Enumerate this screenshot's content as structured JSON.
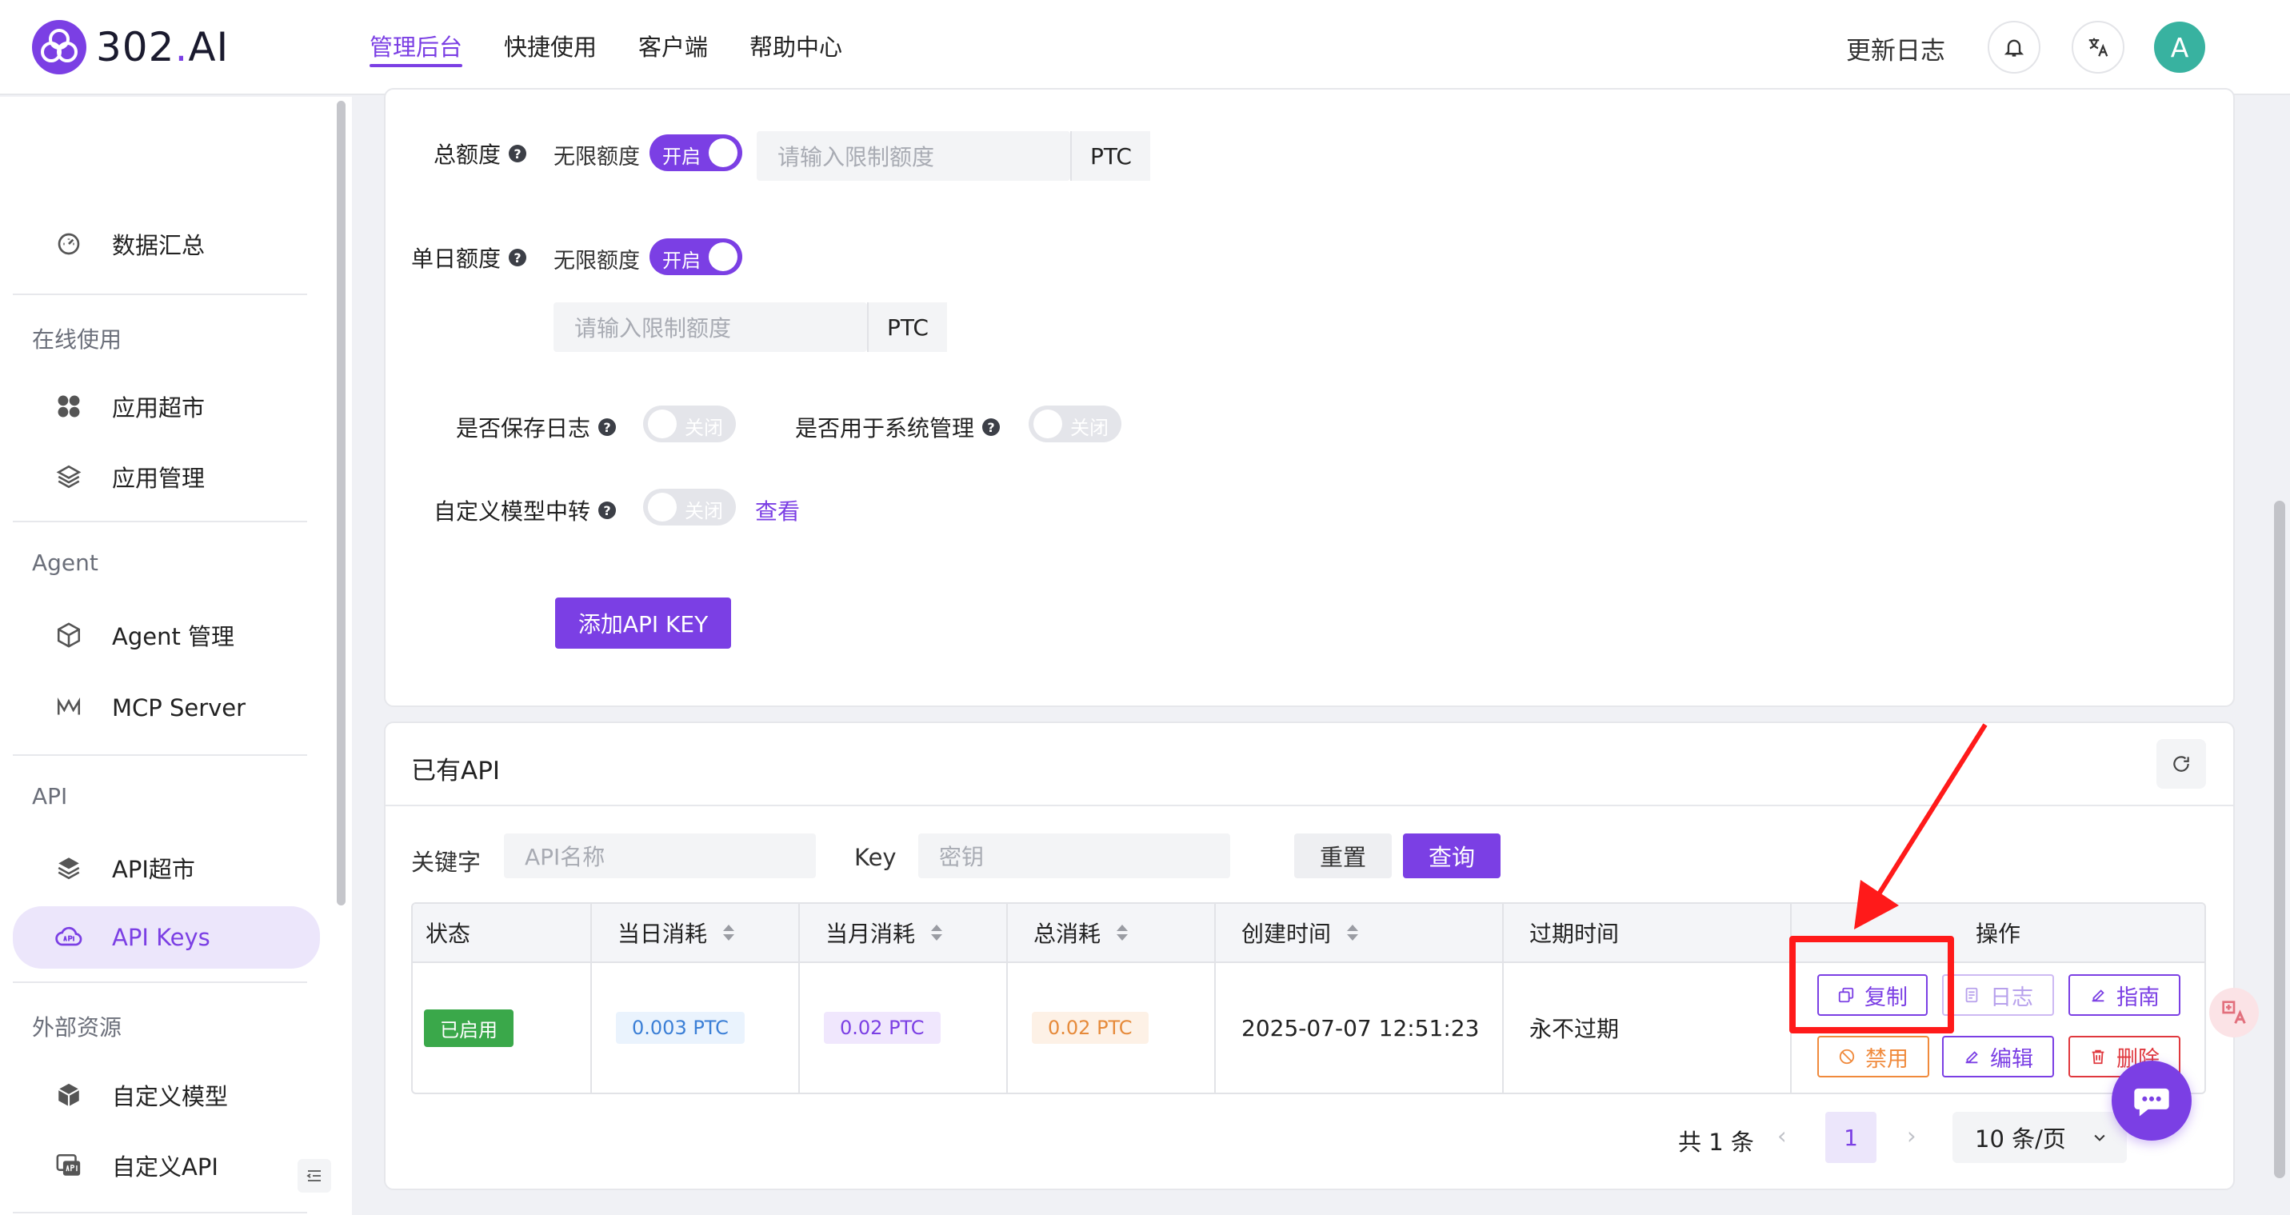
{
  "header": {
    "logo_text": "302",
    "logo_dot": ".",
    "logo_suffix": "AI",
    "nav": [
      "管理后台",
      "快捷使用",
      "客户端",
      "帮助中心"
    ],
    "changelog": "更新日志",
    "avatar_letter": "A"
  },
  "sidebar": {
    "dashboard": "数据汇总",
    "group_online": "在线使用",
    "app_market": "应用超市",
    "app_manage": "应用管理",
    "group_agent": "Agent",
    "agent_manage": "Agent 管理",
    "mcp_server": "MCP Server",
    "group_api": "API",
    "api_market": "API超市",
    "api_keys": "API Keys",
    "group_external": "外部资源",
    "custom_model": "自定义模型",
    "custom_api": "自定义API"
  },
  "form": {
    "total_quota_label": "总额度",
    "daily_quota_label": "单日额度",
    "unlimited_label": "无限额度",
    "toggle_on": "开启",
    "toggle_off": "关闭",
    "limit_placeholder": "请输入限制额度",
    "unit": "PTC",
    "save_log_label": "是否保存日志",
    "system_manage_label": "是否用于系统管理",
    "custom_relay_label": "自定义模型中转",
    "view_link": "查看",
    "add_button": "添加API KEY"
  },
  "api_list": {
    "title": "已有API",
    "keyword_label": "关键字",
    "keyword_placeholder": "API名称",
    "key_label": "Key",
    "key_placeholder": "密钥",
    "reset": "重置",
    "query": "查询",
    "columns": [
      "状态",
      "当日消耗",
      "当月消耗",
      "总消耗",
      "创建时间",
      "过期时间",
      "操作"
    ],
    "rows": [
      {
        "status": "已启用",
        "daily": "0.003 PTC",
        "monthly": "0.02 PTC",
        "total": "0.02 PTC",
        "created": "2025-07-07 12:51:23",
        "expires": "永不过期"
      }
    ],
    "actions": {
      "copy": "复制",
      "log": "日志",
      "guide": "指南",
      "disable": "禁用",
      "edit": "编辑",
      "delete": "删除"
    },
    "pagination": {
      "total": "共 1 条",
      "current_page": "1",
      "page_size": "10 条/页"
    }
  },
  "colors": {
    "accent": "#7b3fe4",
    "status_enabled": "#3aa84a",
    "highlight": "#ff1a1a",
    "delete": "#e0383e",
    "disable": "#f08a3c"
  }
}
